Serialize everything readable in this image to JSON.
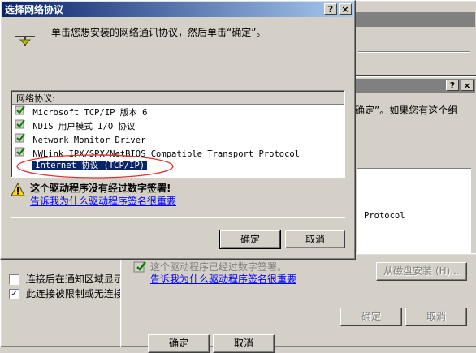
{
  "bg_right_window": {
    "partial_text": "确定”。如果您有这个组",
    "protocol_text": "Protocol"
  },
  "bg_left_window": {
    "checkbox_notify": {
      "label": "连接后在通知区域显示",
      "checked": false
    },
    "checkbox_limited": {
      "label": "此连接被限制或无连接",
      "checked": true
    },
    "bottom_btn_1": "确定",
    "bottom_btn_2": "取消"
  },
  "bg_mid_window": {
    "warning_text": "这个驱动程序已经过数字签署。",
    "link_text": "告诉我为什么驱动程序签名很重要",
    "from_disk_button": "从磁盘安装 (H)...",
    "ok_button": "确定",
    "cancel_button": "取消"
  },
  "dialog": {
    "title": "选择网络协议",
    "help_button": "?",
    "close_button": "×",
    "instruction": "单击您想安装的网络通讯协议，然后单击“确定”。",
    "list_header": "网络协议:",
    "protocols": [
      {
        "label": "Microsoft TCP/IP 版本 6"
      },
      {
        "label": "NDIS 用户模式 I/O 协议"
      },
      {
        "label": "Network Monitor Driver"
      },
      {
        "label": "NWLink IPX/SPX/NetBIOS Compatible Transport Protocol"
      },
      {
        "label": "Internet 协议 (TCP/IP)",
        "selected": true
      }
    ],
    "warning_text": "这个驱动程序没有经过数字签署!",
    "link_text": "告诉我为什么驱动程序签名很重要",
    "ok_button": "确定",
    "cancel_button": "取消"
  },
  "bg_right_dialog": {
    "help_button": "?",
    "close_button": "×"
  },
  "colors": {
    "title_active": "#0a246a",
    "selection": "#0a246a",
    "highlight_circle": "#e03030",
    "link": "#0000ff"
  }
}
